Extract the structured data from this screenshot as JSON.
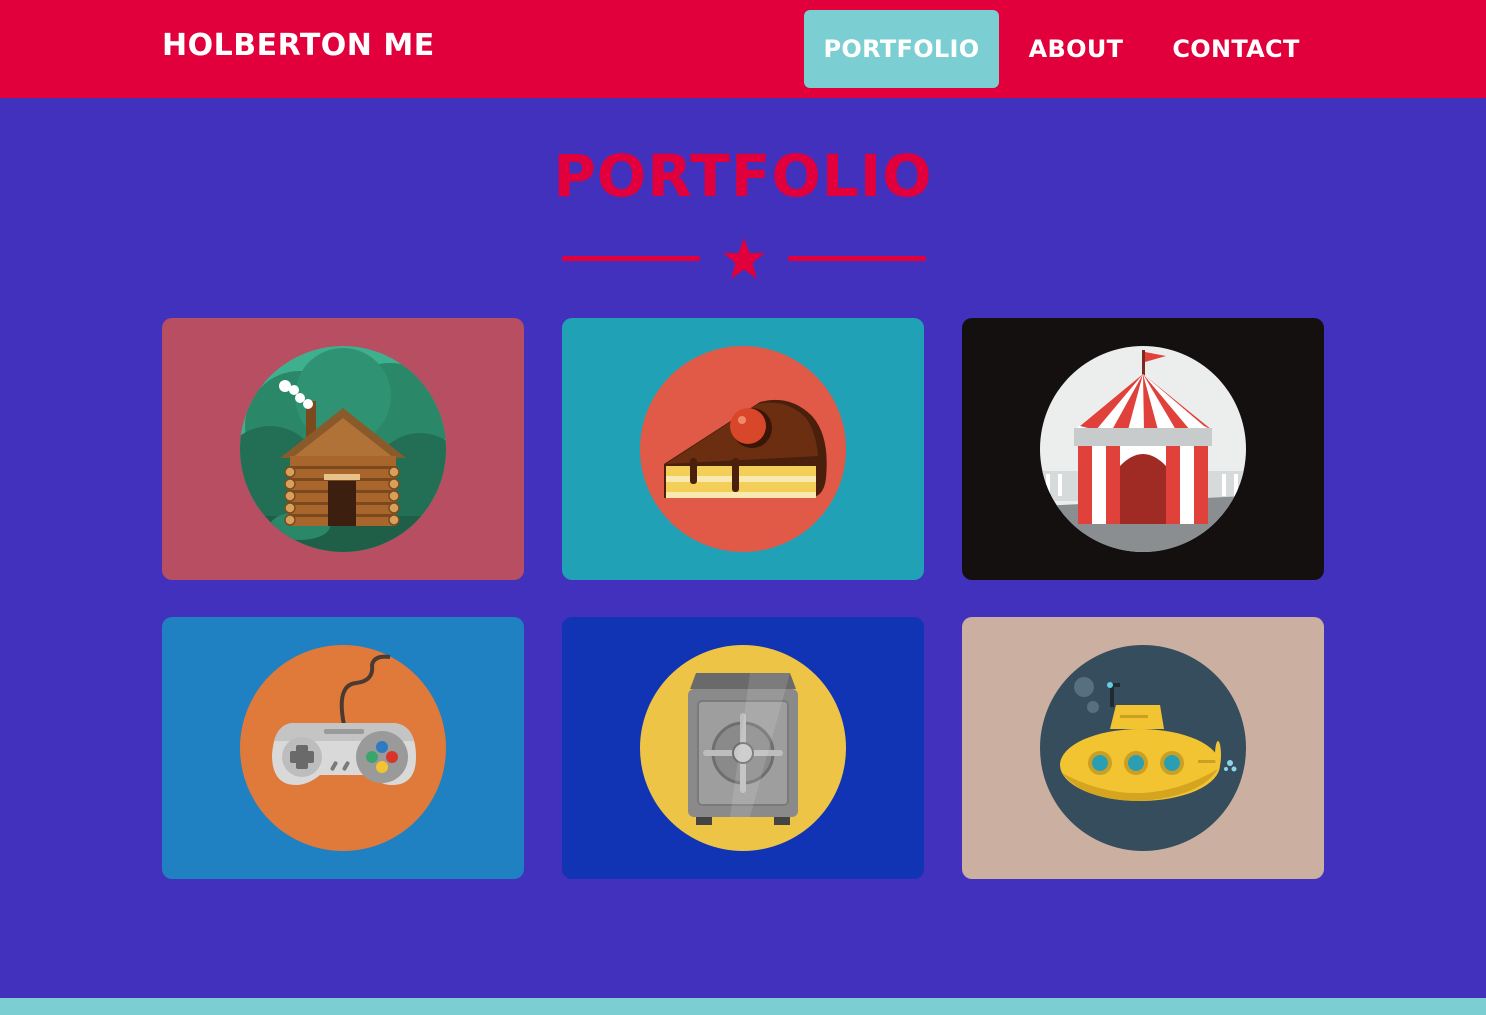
{
  "nav": {
    "brand": "HOLBERTON ME",
    "items": [
      {
        "label": "PORTFOLIO",
        "active": true
      },
      {
        "label": "ABOUT",
        "active": false
      },
      {
        "label": "CONTACT",
        "active": false
      }
    ]
  },
  "portfolio": {
    "title": "PORTFOLIO",
    "divider_icon": "star-icon",
    "items": [
      {
        "icon": "log-cabin-icon",
        "background": "#b84e61",
        "circle": "#2c8a6c"
      },
      {
        "icon": "cake-slice-icon",
        "background": "#21a1b6",
        "circle": "#e05a47"
      },
      {
        "icon": "circus-tent-icon",
        "background": "#141010",
        "circle": "#eceeee"
      },
      {
        "icon": "game-controller-icon",
        "background": "#1f80c2",
        "circle": "#e07a3a"
      },
      {
        "icon": "safe-icon",
        "background": "#1034b4",
        "circle": "#eec446"
      },
      {
        "icon": "submarine-icon",
        "background": "#cbb0a2",
        "circle": "#364d5e"
      }
    ]
  },
  "colors": {
    "page_background": "#4231bc",
    "navbar": "#e1003c",
    "active_nav": "#7bcfd3",
    "accent": "#e1003c",
    "footer": "#7bcfd3"
  }
}
